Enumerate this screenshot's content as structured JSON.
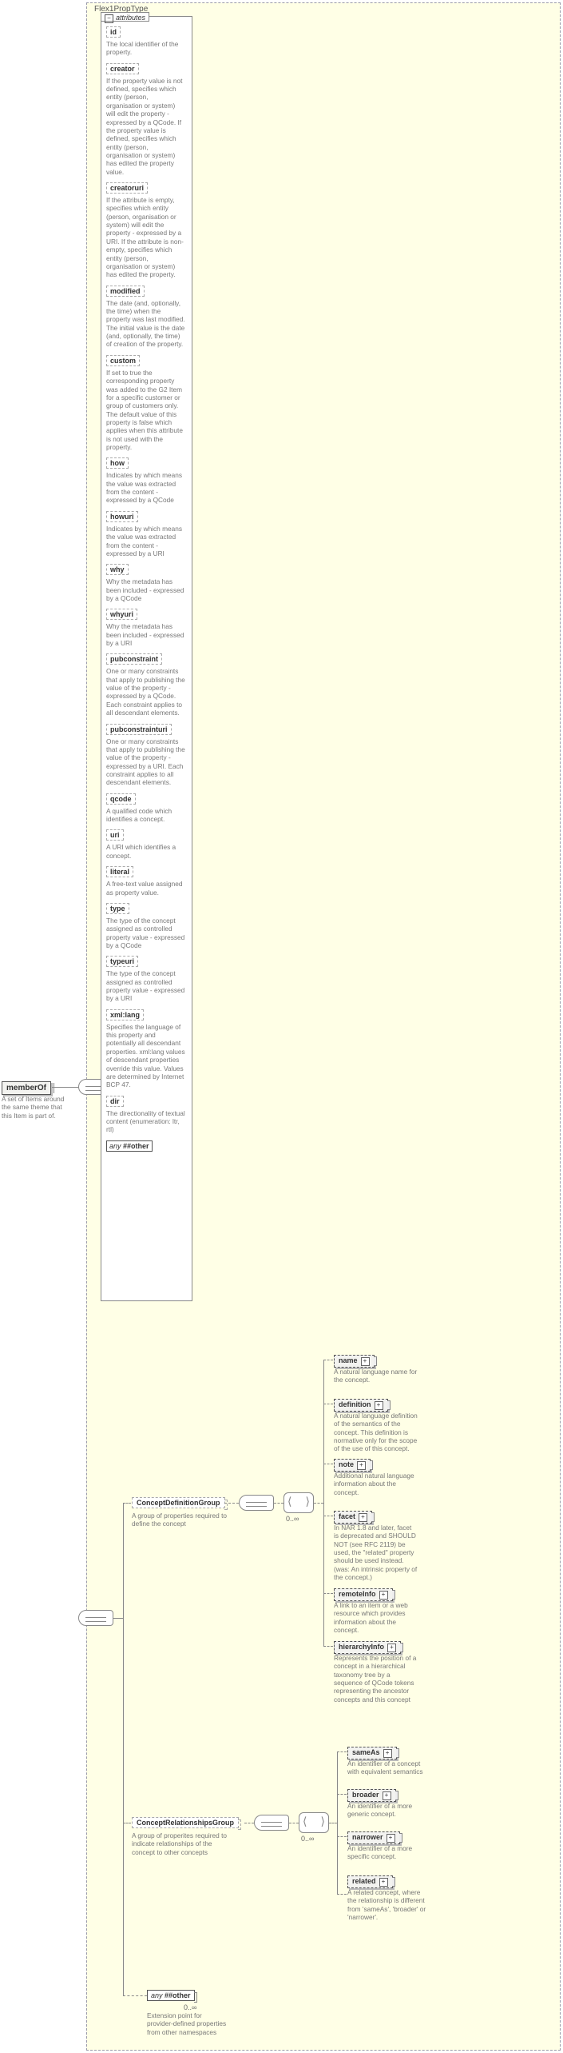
{
  "outer": {
    "type_label": "Flex1PropType"
  },
  "root": {
    "label": "memberOf",
    "desc": "A set of Items around the same theme that this Item is part of."
  },
  "occ": "0..∞",
  "attributes": {
    "tab": "attributes",
    "items": [
      {
        "name": "id",
        "desc": "The local identifier of the property."
      },
      {
        "name": "creator",
        "desc": "If the property value is not defined, specifies which entity (person, organisation or system) will edit the property - expressed by a QCode. If the property value is defined, specifies which entity (person, organisation or system) has edited the property value."
      },
      {
        "name": "creatoruri",
        "desc": "If the attribute is empty, specifies which entity (person, organisation or system) will edit the property - expressed by a URI. If the attribute is non-empty, specifies which entity (person, organisation or system) has edited the property."
      },
      {
        "name": "modified",
        "desc": "The date (and, optionally, the time) when the property was last modified. The initial value is the date (and, optionally, the time) of creation of the property."
      },
      {
        "name": "custom",
        "desc": "If set to true the corresponding property was added to the G2 Item for a specific customer or group of customers only. The default value of this property is false which applies when this attribute is not used with the property."
      },
      {
        "name": "how",
        "desc": "Indicates by which means the value was extracted from the content - expressed by a QCode"
      },
      {
        "name": "howuri",
        "desc": "Indicates by which means the value was extracted from the content - expressed by a URI"
      },
      {
        "name": "why",
        "desc": "Why the metadata has been included - expressed by a QCode"
      },
      {
        "name": "whyuri",
        "desc": "Why the metadata has been included - expressed by a URI"
      },
      {
        "name": "pubconstraint",
        "desc": "One or many constraints that apply to publishing the value of the property - expressed by a QCode. Each constraint applies to all descendant elements."
      },
      {
        "name": "pubconstrainturi",
        "desc": "One or many constraints that apply to publishing the value of the property - expressed by a URI. Each constraint applies to all descendant elements."
      },
      {
        "name": "qcode",
        "desc": "A qualified code which identifies a concept."
      },
      {
        "name": "uri",
        "desc": "A URI which identifies a concept."
      },
      {
        "name": "literal",
        "desc": "A free-text value assigned as property value."
      },
      {
        "name": "type",
        "desc": "The type of the concept assigned as controlled property value - expressed by a QCode"
      },
      {
        "name": "typeuri",
        "desc": "The type of the concept assigned as controlled property value - expressed by a URI"
      },
      {
        "name": "xml:lang",
        "desc": "Specifies the language of this property and potentially all descendant properties. xml:lang values of descendant properties override this value. Values are determined by Internet BCP 47."
      },
      {
        "name": "dir",
        "desc": "The directionality of textual content (enumeration: ltr, rtl)"
      }
    ],
    "anyOther": {
      "any": "any",
      "other": "##other"
    }
  },
  "groups": [
    {
      "name": "ConceptDefinitionGroup",
      "desc": "A group of properties required to define the concept",
      "children": [
        {
          "name": "name",
          "desc": "A natural language name for the concept."
        },
        {
          "name": "definition",
          "desc": "A natural language definition of the semantics of the concept. This definition is normative only for the scope of the use of this concept."
        },
        {
          "name": "note",
          "desc": "Additional natural language information about the concept."
        },
        {
          "name": "facet",
          "desc": "In NAR 1.8 and later, facet is deprecated and SHOULD NOT (see RFC 2119) be used, the \"related\" property should be used instead. (was: An intrinsic property of the concept.)"
        },
        {
          "name": "remoteInfo",
          "desc": "A link to an item or a web resource which provides information about the concept."
        },
        {
          "name": "hierarchyInfo",
          "desc": "Represents the position of a concept in a hierarchical taxonomy tree by a sequence of QCode tokens representing the ancestor concepts and this concept"
        }
      ]
    },
    {
      "name": "ConceptRelationshipsGroup",
      "desc": "A group of properites required to indicate relationships of the concept to other concepts",
      "children": [
        {
          "name": "sameAs",
          "desc": "An identifier of a concept with equivalent semantics"
        },
        {
          "name": "broader",
          "desc": "An identifier of a more generic concept."
        },
        {
          "name": "narrower",
          "desc": "An identifier of a more specific concept."
        },
        {
          "name": "related",
          "desc": "A related concept, where the relationship is different from 'sameAs', 'broader' or 'narrower'."
        }
      ]
    }
  ],
  "anyOtherElement": {
    "any": "any",
    "other": "##other",
    "desc": "Extension point for provider-defined properties from other namespaces"
  }
}
